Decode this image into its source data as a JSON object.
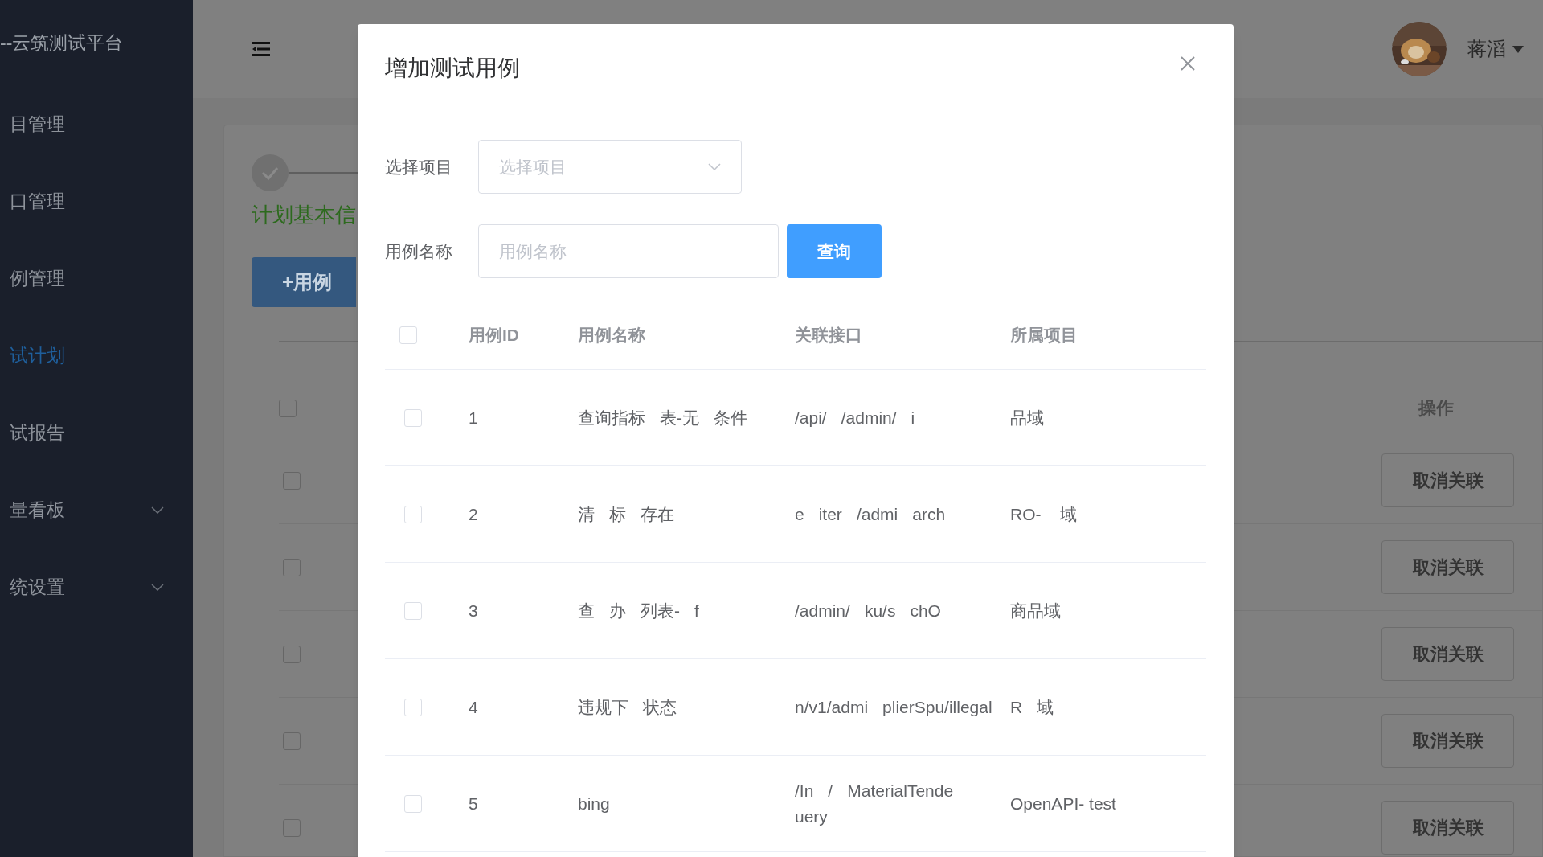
{
  "sidebar": {
    "title": "--云筑测试平台",
    "items": [
      {
        "label": "目管理",
        "selected": false,
        "expandable": false
      },
      {
        "label": "口管理",
        "selected": false,
        "expandable": false
      },
      {
        "label": "例管理",
        "selected": false,
        "expandable": false
      },
      {
        "label": "试计划",
        "selected": true,
        "expandable": false
      },
      {
        "label": "试报告",
        "selected": false,
        "expandable": false
      },
      {
        "label": "量看板",
        "selected": false,
        "expandable": true
      },
      {
        "label": "统设置",
        "selected": false,
        "expandable": true
      }
    ]
  },
  "header": {
    "user": "蒋滔"
  },
  "page": {
    "step_title": "计划基本信",
    "add_button": "+用例",
    "table": {
      "action_column": "操作",
      "header_checked": false,
      "rows": [
        {
          "checked": false,
          "action": "取消关联"
        },
        {
          "checked": false,
          "action": "取消关联"
        },
        {
          "checked": false,
          "action": "取消关联"
        },
        {
          "checked": false,
          "action": "取消关联"
        },
        {
          "checked": false,
          "action": "取消关联"
        }
      ]
    }
  },
  "dialog": {
    "title": "增加测试用例",
    "fields": [
      {
        "kind": "select",
        "label": "选择项目",
        "placeholder": "选择项目"
      },
      {
        "kind": "input",
        "label": "用例名称",
        "placeholder": "用例名称"
      }
    ],
    "search_button": "查询",
    "table": {
      "header_checked": false,
      "columns": [
        "用例ID",
        "用例名称",
        "关联接口",
        "所属项目"
      ],
      "rows": [
        {
          "checked": false,
          "id": "1",
          "name": [
            "查询指标",
            "表-无",
            "条件"
          ],
          "interface": [
            "/api/",
            "/admin/",
            "i"
          ],
          "project": "品域"
        },
        {
          "checked": false,
          "id": "2",
          "name": [
            "清",
            "标",
            "存在"
          ],
          "interface": [
            "e",
            "iter",
            "/admi",
            "arch"
          ],
          "project": "RO-    域"
        },
        {
          "checked": false,
          "id": "3",
          "name": [
            "查",
            "办",
            "列表-",
            "f"
          ],
          "interface": [
            "/admin/",
            "ku/s",
            "chO"
          ],
          "project": "商品域"
        },
        {
          "checked": false,
          "id": "4",
          "name": [
            "违规下",
            "状态"
          ],
          "interface": [
            "n/v1/admi",
            "plierSpu/illegal"
          ],
          "project": "R   域"
        },
        {
          "checked": false,
          "id": "5",
          "name": [
            "bing"
          ],
          "interface": [
            "/In",
            "/",
            "MaterialTende",
            "uery"
          ],
          "project": "OpenAPI- test"
        }
      ]
    }
  }
}
